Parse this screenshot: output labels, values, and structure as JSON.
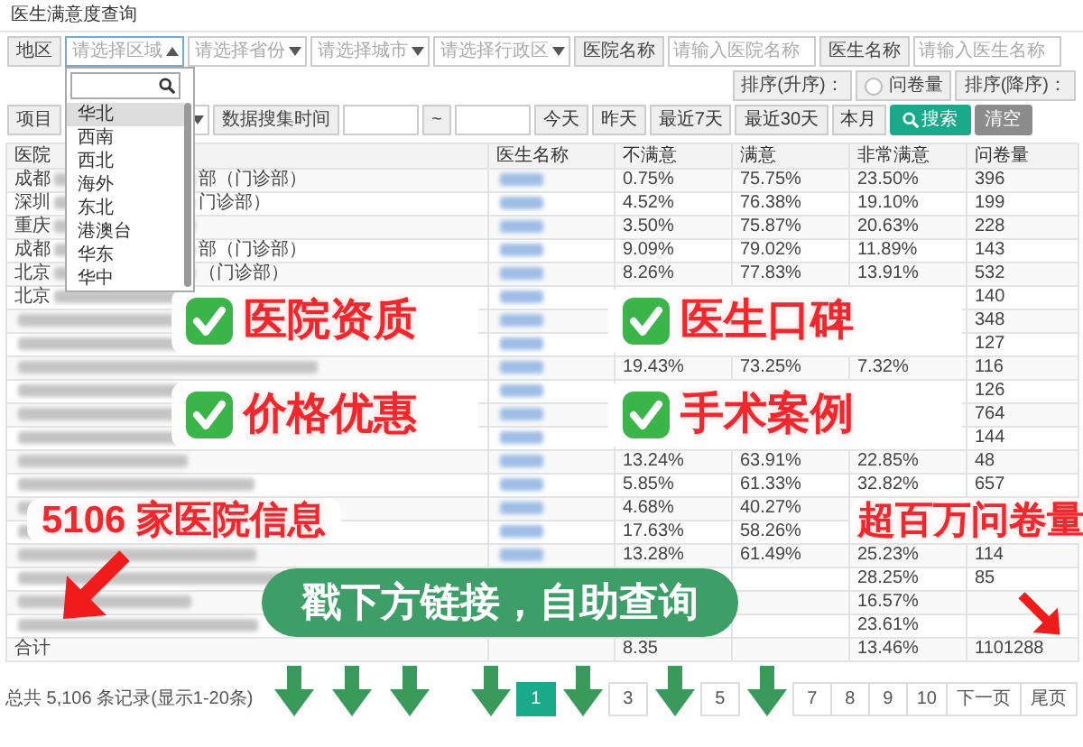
{
  "page_title": "医生满意度查询",
  "filters": {
    "region": {
      "label": "地区",
      "placeholder": "请选择区域",
      "expanded": true
    },
    "selects": [
      {
        "placeholder": "请选择省份"
      },
      {
        "placeholder": "请选择城市"
      },
      {
        "placeholder": "请选择行政区"
      }
    ],
    "hospital": {
      "label": "医院名称",
      "placeholder": "请输入医院名称"
    },
    "doctor": {
      "label": "医生名称",
      "placeholder": "请输入医生名称"
    },
    "sort_asc": {
      "label": "排序(升序)：",
      "options": [
        {
          "label": "问卷量",
          "selected": false
        }
      ]
    },
    "sort_desc": {
      "label": "排序(降序)："
    },
    "project": {
      "label": "项目"
    },
    "date": {
      "label": "数据搜集时间",
      "separator": "~"
    },
    "quick_ranges": [
      "今天",
      "昨天",
      "最近7天",
      "最近30天",
      "本月"
    ],
    "search_button": "搜索",
    "reset_button": {
      "label": "清空",
      "disabled": true
    }
  },
  "region_dropdown": {
    "items": [
      {
        "label": "华北",
        "selected": true
      },
      {
        "label": "西南",
        "selected": false
      },
      {
        "label": "西北",
        "selected": false
      },
      {
        "label": "海外",
        "selected": false
      },
      {
        "label": "东北",
        "selected": false
      },
      {
        "label": "港澳台",
        "selected": false
      },
      {
        "label": "华东",
        "selected": false
      },
      {
        "label": "华中",
        "selected": false
      }
    ]
  },
  "table": {
    "columns": [
      "医院",
      "医生名称",
      "不满意",
      "满意",
      "非常满意",
      "问卷量"
    ],
    "rows": [
      {
        "hospital_end": "部（门诊部）",
        "cells": [
          "成都",
          "",
          "0.75%",
          "75.75%",
          "23.50%",
          "396"
        ]
      },
      {
        "hospital_end": "门诊部）",
        "cells": [
          "深圳",
          "",
          "4.52%",
          "76.38%",
          "19.10%",
          "199"
        ]
      },
      {
        "cells": [
          "重庆",
          "",
          "3.50%",
          "75.87%",
          "20.63%",
          "228"
        ]
      },
      {
        "hospital_end": "部（门诊部）",
        "cells": [
          "成都",
          "",
          "9.09%",
          "79.02%",
          "11.89%",
          "143"
        ]
      },
      {
        "hospital_end": "（门诊部）",
        "cells": [
          "北京",
          "",
          "8.26%",
          "77.83%",
          "13.91%",
          "532"
        ]
      },
      {
        "cells": [
          "北京",
          "",
          "",
          "",
          "",
          "140"
        ]
      },
      {
        "cells": [
          "",
          "",
          "",
          "",
          "",
          "348"
        ]
      },
      {
        "cells": [
          "",
          "",
          "",
          "",
          "",
          "127"
        ]
      },
      {
        "cells": [
          "",
          "",
          "19.43%",
          "73.25%",
          "7.32%",
          "116"
        ]
      },
      {
        "cells": [
          "",
          "",
          "",
          "",
          "",
          "126"
        ]
      },
      {
        "cells": [
          "",
          "",
          "",
          "",
          "",
          "764"
        ]
      },
      {
        "cells": [
          "",
          "",
          "",
          "",
          "",
          "144"
        ]
      },
      {
        "cells": [
          "",
          "",
          "13.24%",
          "63.91%",
          "22.85%",
          "48"
        ]
      },
      {
        "cells": [
          "",
          "",
          "5.85%",
          "61.33%",
          "32.82%",
          "657"
        ]
      },
      {
        "cells": [
          "",
          "",
          "4.68%",
          "40.27%",
          "",
          ""
        ]
      },
      {
        "cells": [
          "",
          "",
          "17.63%",
          "58.26%",
          "",
          ""
        ]
      },
      {
        "cells": [
          "",
          "",
          "13.28%",
          "61.49%",
          "25.23%",
          "114"
        ]
      },
      {
        "cells": [
          "",
          "",
          "",
          "",
          "28.25%",
          "85"
        ]
      },
      {
        "cells": [
          "",
          "",
          "",
          "",
          "16.57%",
          ""
        ]
      },
      {
        "cells": [
          "",
          "",
          "",
          "",
          "23.61%",
          ""
        ]
      }
    ],
    "total": {
      "cells": [
        "合计",
        "",
        "8.35",
        "",
        "13.46%",
        "1101288"
      ]
    }
  },
  "summary": "总共 5,106 条记录(显示1-20条)",
  "pagination": [
    {
      "kind": "arrow"
    },
    {
      "kind": "page",
      "label": "1",
      "selected": true
    },
    {
      "kind": "arrow"
    },
    {
      "kind": "page",
      "label": "3",
      "selected": false
    },
    {
      "kind": "arrow"
    },
    {
      "kind": "page",
      "label": "5",
      "selected": false
    },
    {
      "kind": "arrow"
    },
    {
      "kind": "page",
      "label": "7",
      "selected": false
    },
    {
      "kind": "page",
      "label": "8",
      "selected": false
    },
    {
      "kind": "page",
      "label": "9",
      "selected": false
    },
    {
      "kind": "page",
      "label": "10",
      "selected": false
    },
    {
      "kind": "page",
      "label": "下一页",
      "selected": false
    },
    {
      "kind": "page",
      "label": "尾页",
      "selected": false
    }
  ],
  "promo": {
    "features": [
      "医院资质",
      "医生口碑",
      "价格优惠",
      "手术案例"
    ],
    "hospital_count": "5106 家医院信息",
    "survey_count": "超百万问卷量",
    "cta": "戳下方链接，自助查询"
  }
}
